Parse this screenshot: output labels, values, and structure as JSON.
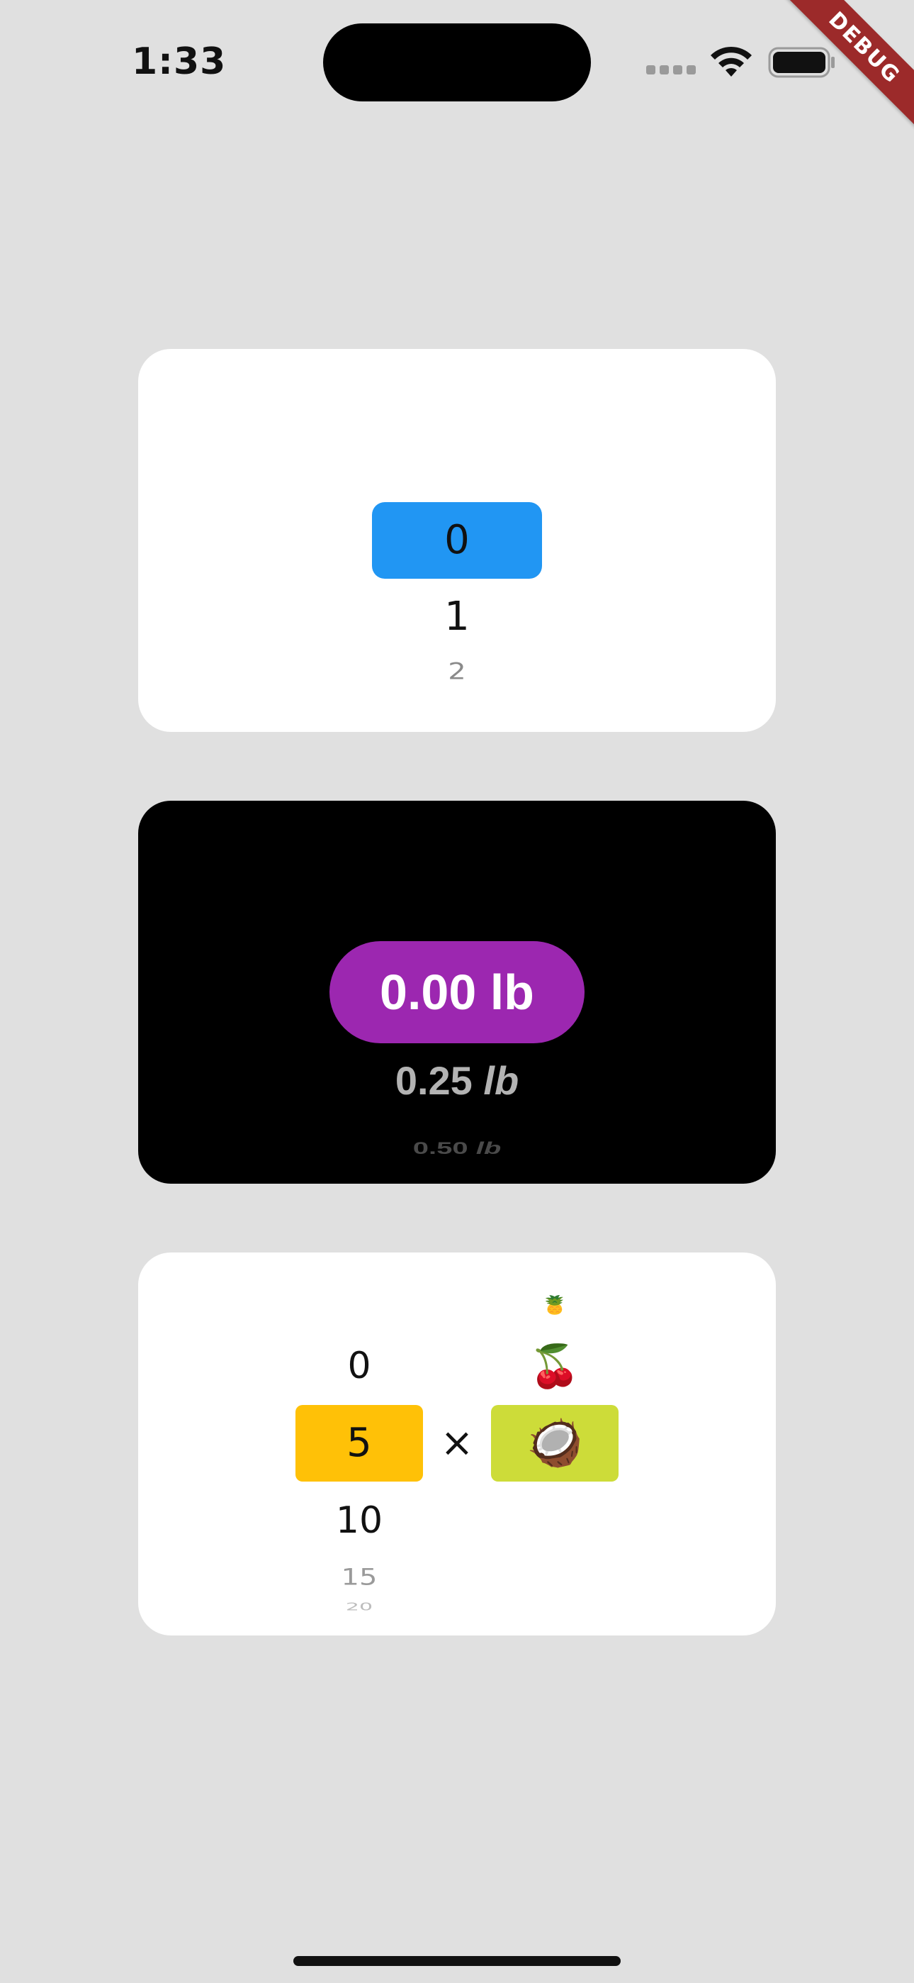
{
  "status_bar": {
    "time": "1:33",
    "debug_label": "DEBUG"
  },
  "integer_picker": {
    "selected": "0",
    "next_1": "1",
    "next_2": "2",
    "highlight_color": "#2196f3"
  },
  "decimal_picker": {
    "selected": "0.00 lb",
    "next_1_value": "0.25",
    "next_1_unit": "lb",
    "next_2_value": "0.50",
    "next_2_unit": "lb",
    "highlight_color": "#9c27b0"
  },
  "combo_picker": {
    "numbers": {
      "prev_1": "0",
      "selected": "5",
      "next_1": "10",
      "next_2": "15",
      "next_3": "20",
      "highlight_color": "#ffc107"
    },
    "operator": "×",
    "fruits": {
      "prev_2": "🍍",
      "prev_1": "🍒",
      "selected": "🥥",
      "highlight_color": "#cddc39"
    }
  }
}
